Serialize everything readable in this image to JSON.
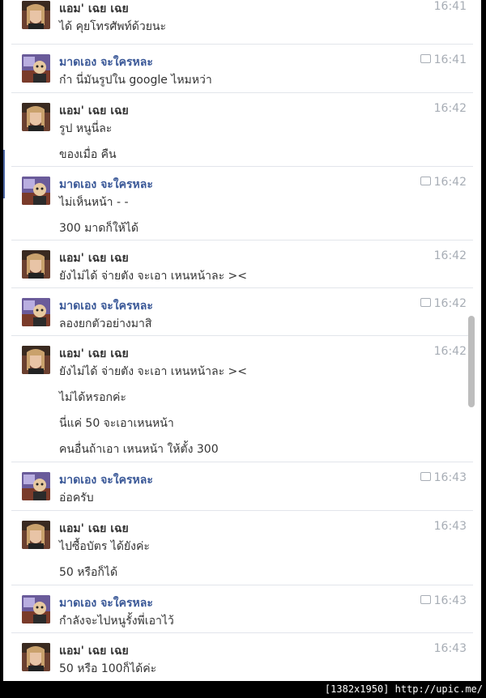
{
  "messages": [
    {
      "sender": "แอม' เฉย เฉย",
      "kind": "girl",
      "time": "16:41",
      "time_icon": false,
      "lines": [
        "ได้ คุยโทรศัพท์ด้วยนะ"
      ]
    },
    {
      "sender": "มาดเอง จะใครหละ",
      "kind": "boy",
      "time": "16:41",
      "time_icon": true,
      "lines": [
        "ก๋า นี่มันรูปใน google ไหมหว่า"
      ]
    },
    {
      "sender": "แอม' เฉย เฉย",
      "kind": "girl",
      "time": "16:42",
      "time_icon": false,
      "lines": [
        "รูป หนูนี่ละ",
        "ของเมื่อ คืน"
      ]
    },
    {
      "sender": "มาดเอง จะใครหละ",
      "kind": "boy",
      "time": "16:42",
      "time_icon": true,
      "lines": [
        "ไม่เห็นหน้า - -",
        "300 มาดก็ให้ได้"
      ]
    },
    {
      "sender": "แอม' เฉย เฉย",
      "kind": "girl",
      "time": "16:42",
      "time_icon": false,
      "lines": [
        "ยังไม่ได้ จ่ายตัง จะเอา เหนหน้าละ ><"
      ]
    },
    {
      "sender": "มาดเอง จะใครหละ",
      "kind": "boy",
      "time": "16:42",
      "time_icon": true,
      "lines": [
        "ลองยกตัวอย่างมาสิ"
      ]
    },
    {
      "sender": "แอม' เฉย เฉย",
      "kind": "girl",
      "time": "16:42",
      "time_icon": false,
      "lines": [
        "ยังไม่ได้ จ่ายตัง จะเอา เหนหน้าละ ><",
        "ไม่ได้หรอกค่ะ",
        "นี่แค่ 50 จะเอาเหนหน้า",
        "คนอื่นถ้าเอา เหนหน้า ให้ตั้ง 300"
      ]
    },
    {
      "sender": "มาดเอง จะใครหละ",
      "kind": "boy",
      "time": "16:43",
      "time_icon": true,
      "lines": [
        "อ่อครับ"
      ]
    },
    {
      "sender": "แอม' เฉย เฉย",
      "kind": "girl",
      "time": "16:43",
      "time_icon": false,
      "lines": [
        "ไปซื้อบัตร ได้ยังค่ะ",
        "50 หรือก็ได้"
      ]
    },
    {
      "sender": "มาดเอง จะใครหละ",
      "kind": "boy",
      "time": "16:43",
      "time_icon": true,
      "lines": [
        "กำลังจะไปหนูรั้งพี่เอาไว้"
      ]
    },
    {
      "sender": "แอม' เฉย เฉย",
      "kind": "girl",
      "time": "16:43",
      "time_icon": false,
      "lines": [
        "50 หรือ 100ก็ได้ค่ะ"
      ]
    }
  ],
  "footer": "[1382x1950] http://upic.me/"
}
